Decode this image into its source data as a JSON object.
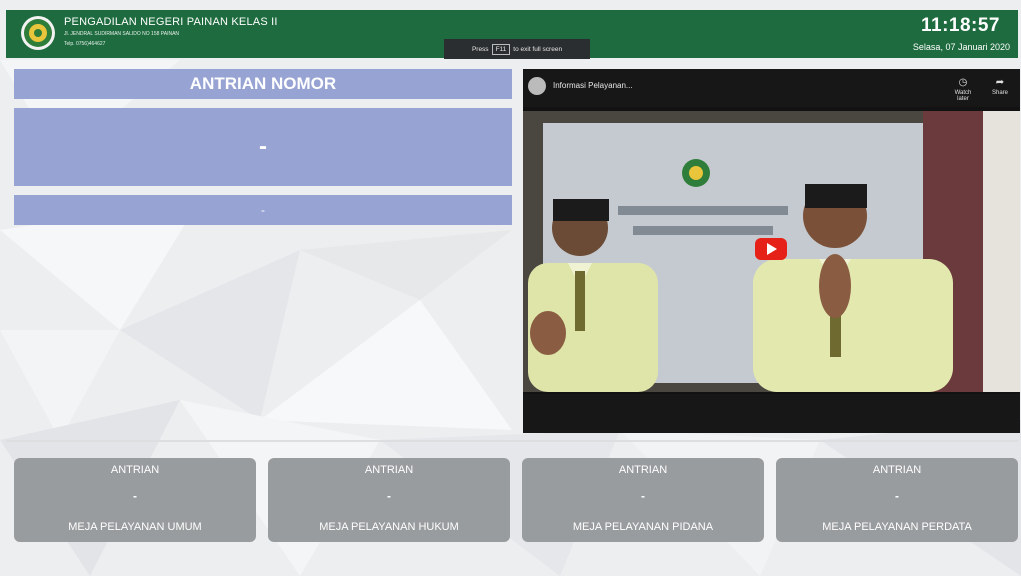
{
  "header": {
    "org_name": "PENGADILAN NEGERI PAINAN KELAS II",
    "address": "Jl. JENDRAL SUDIRMAN SALIDO NO 158 PAINAN",
    "phone": "Telp. 0756)464627",
    "time": "11:18:57",
    "date": "Selasa, 07 Januari 2020",
    "brand_color": "#1d6b3e"
  },
  "fullscreen_notice": {
    "press": "Press",
    "key": "F11",
    "rest": "to exit full screen"
  },
  "antrian": {
    "title": "ANTRIAN NOMOR",
    "number": "-",
    "sub": "-",
    "panel_color": "#97a3d3"
  },
  "video": {
    "title": "Informasi Pelayanan...",
    "watch_later": "Watch later",
    "share": "Share",
    "watch_later_icon": "clock-icon",
    "share_icon": "share-icon",
    "play_icon": "youtube-play-icon"
  },
  "counters": [
    {
      "label": "ANTRIAN",
      "number": "-",
      "name": "MEJA PELAYANAN UMUM"
    },
    {
      "label": "ANTRIAN",
      "number": "-",
      "name": "MEJA PELAYANAN HUKUM"
    },
    {
      "label": "ANTRIAN",
      "number": "-",
      "name": "MEJA PELAYANAN PIDANA"
    },
    {
      "label": "ANTRIAN",
      "number": "-",
      "name": "MEJA PELAYANAN PERDATA"
    }
  ]
}
